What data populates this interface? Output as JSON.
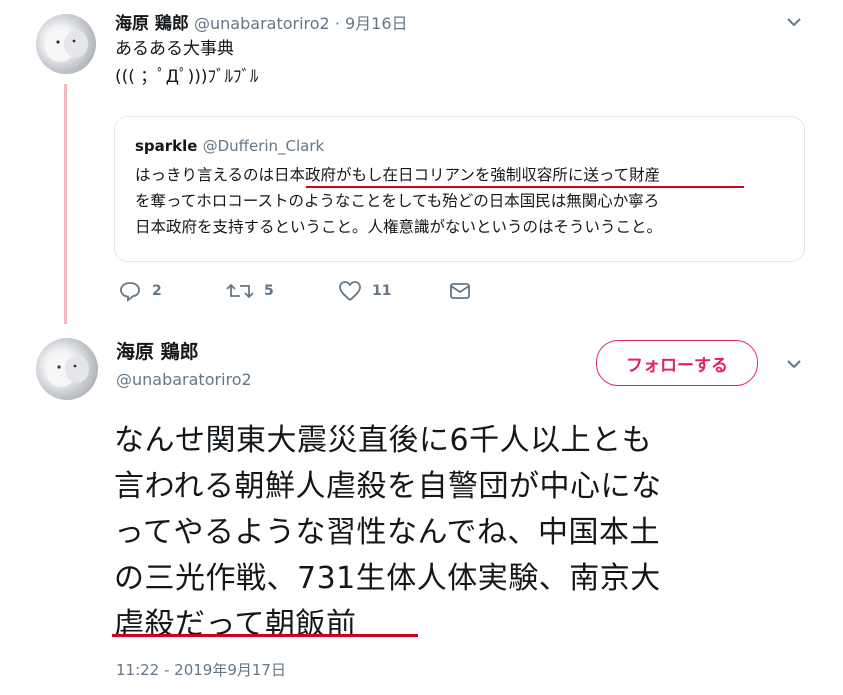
{
  "tweet1": {
    "name": "海原 鶏郎",
    "handle": "@unabaratoriro2",
    "date": "· 9月16日",
    "line1": "あるある大事典",
    "line2": "((( ；ﾟДﾟ)))ﾌﾞﾙﾌﾞﾙ",
    "quote": {
      "name": "sparkle",
      "handle": "@Dufferin_Clark",
      "lines": [
        "はっきり言えるのは日本政府がもし在日コリアンを強制収容所に送って財産",
        "を奪ってホロコーストのようなことをしても殆どの日本国民は無関心か寧ろ",
        "日本政府を支持するということ。人権意識がないというのはそういうこと。"
      ]
    },
    "actions": {
      "replies": "2",
      "retweets": "5",
      "likes": "11"
    }
  },
  "tweet2": {
    "name": "海原 鶏郎",
    "handle": "@unabaratoriro2",
    "follow_label": "フォローする",
    "lines": [
      "なんせ関東大震災直後に6千人以上とも",
      "言われる朝鮮人虐殺を自警団が中心にな",
      "ってやるような習性なんでね、中国本土",
      "の三光作戦、731生体人体実験、南京大",
      "虐殺だって朝飯前"
    ],
    "timestamp": "11:22 - 2019年9月17日"
  },
  "colors": {
    "accent_red": "#e0245e",
    "underline_red": "#d0021b",
    "thread_pink": "#f4b9c0",
    "muted": "#657786"
  },
  "icons": [
    "reply-icon",
    "retweet-icon",
    "like-icon",
    "message-icon",
    "chevron-down-icon"
  ]
}
